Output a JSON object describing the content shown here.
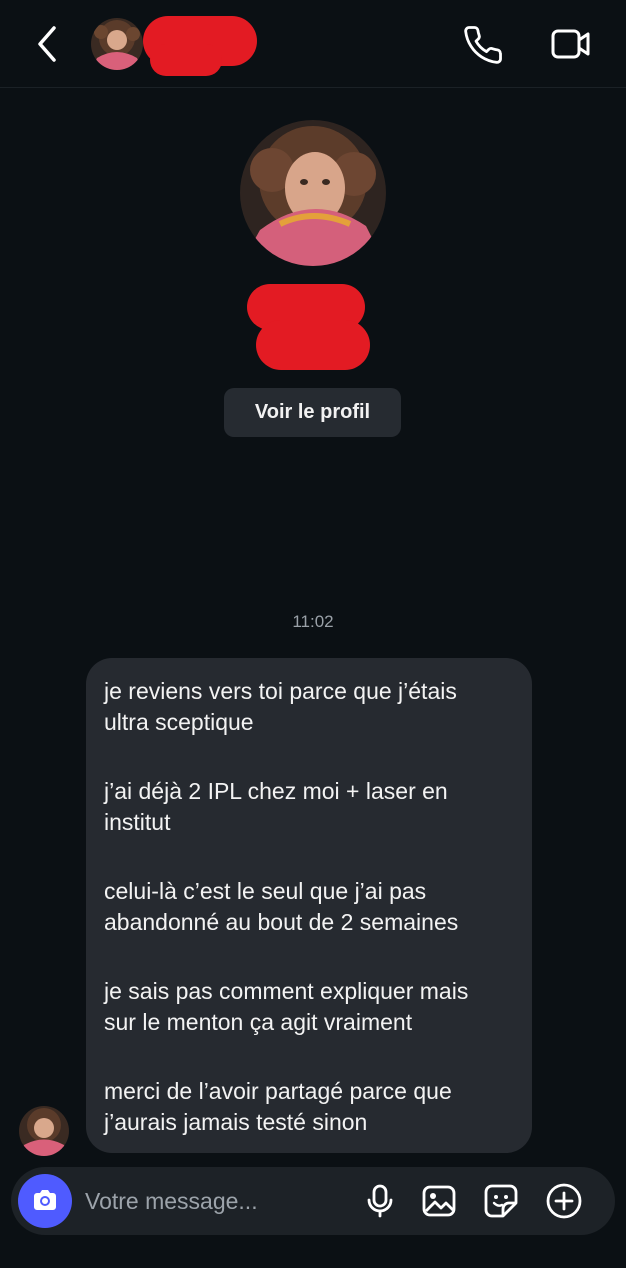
{
  "header": {
    "back_icon": "chevron-left-icon",
    "call_icon": "phone-icon",
    "video_icon": "video-camera-icon"
  },
  "profile": {
    "view_profile_label": "Voir le profil"
  },
  "conversation": {
    "timestamp": "11:02",
    "message": {
      "paragraphs": [
        "je reviens vers toi parce que j’étais\nultra sceptique",
        "j’ai déjà 2 IPL chez moi + laser en\ninstitut",
        "celui-là c’est le seul que j’ai pas\nabandonné au bout de 2 semaines",
        "je sais pas comment expliquer mais\nsur le menton ça agit vraiment",
        "merci de l’avoir partagé parce que\nj’aurais jamais testé sinon"
      ]
    }
  },
  "composer": {
    "placeholder": "Votre message...",
    "camera_icon": "camera-icon",
    "mic_icon": "microphone-icon",
    "gallery_icon": "image-icon",
    "sticker_icon": "sticker-icon",
    "plus_icon": "plus-circle-icon"
  },
  "colors": {
    "background": "#0b1014",
    "bubble": "#262a30",
    "accent": "#4f5bff",
    "redaction": "#e31b23"
  }
}
